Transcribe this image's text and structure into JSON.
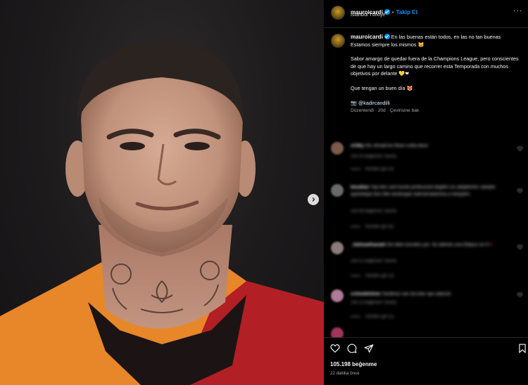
{
  "post": {
    "username": "mauroicardi",
    "follow_label": "Takip Et",
    "location": "İstanbul Türkiye"
  },
  "caption": {
    "username": "mauroicardi",
    "line1": "En las buenas están todos, en las no tan buenas Estamos siempre los mismos 😸",
    "line2": "Sabor amargo de quedar fuera de la Champions League, pero conscientes de que hay un largo camino que recorrer esta Temporada con muchos objetivos por delante 💛❤",
    "line3": "Que tengan un buen día 😻",
    "credit": "📷 @kadircandilli",
    "edited": "Düzenlendi · 20d",
    "translate": "Çevirisine bak"
  },
  "comments": [
    {
      "user": "ch3ky",
      "text": "Hic olmadi be Ebun nolla ebun",
      "meta": "20d  40 beğenme  Yanıtla",
      "reply": "Yanıtları gör (4)"
    },
    {
      "user": "bezaltan",
      "text": "Yap ben seni bunle profesonel degilim ve rakiplerinin sahabe ayandaiyiz bun bile durdurgas katmamalarinna a isteyiyim.",
      "meta": "20d  98 beğenme  Yanıtla",
      "reply": "Yanıtları gör (6)"
    },
    {
      "user": "_fatimaelhanaki",
      "text": "Hic bilim konoliru yer. Sz takimin una Ebipos ve 9",
      "meta": "20d  41 beğenme  Yanıtla",
      "reply": "Yanıtları gör (3)"
    },
    {
      "user": "crimedelshee",
      "text": "Yandirsin sen da ister ayn adarsin",
      "meta": "20d  23 beğenme  Yanıtla",
      "reply": "Yanıtları gör (2)"
    }
  ],
  "actions": {
    "likes": "105.198 beğenme",
    "time": "22 dakika önce"
  },
  "colors": {
    "accent": "#0095f6",
    "jersey_orange": "#e8862a",
    "jersey_red": "#b21f24"
  }
}
